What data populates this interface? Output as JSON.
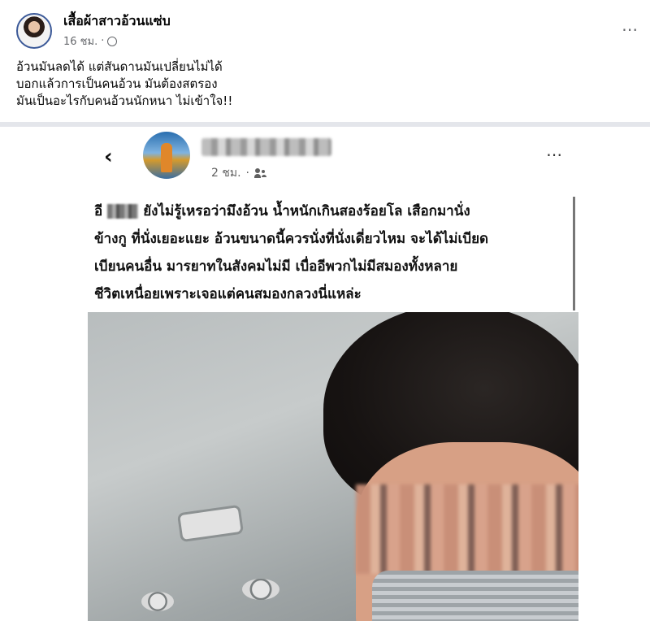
{
  "post": {
    "author": "เสื้อผ้าสาวอ้วนแซ่บ",
    "time": "16 ชม.",
    "more_icon": "⋯",
    "text_lines": [
      "อ้วนมันลดได้ แต่สันดานมันเปลี่ยนไม่ได้",
      "บอกแล้วการเป็นคนอ้วน มันต้องสตรอง",
      "มันเป็นอะไรกับคนอ้วนนักหนา ไม่เข้าใจ!!"
    ]
  },
  "screenshot": {
    "back_icon": "‹",
    "time": "2 ชม.",
    "more_icon": "⋯",
    "quote_prefix": "อี",
    "quote_lines": [
      "ยังไม่รู้เหรอว่ามึงอ้วน น้ำหนักเกินสองร้อยโล เสือกมานั่ง",
      "ข้างกู ที่นั่งเยอะแยะ อ้วนขนาดนี้ควรนั่งที่นั่งเดี่ยวไหม จะได้ไม่เบียด",
      "เบียนคนอื่น มารยาทในสังคมไม่มี เบื่ออีพวกไม่มีสมองทั้งหลาย",
      "ชีวิตเหนื่อยเพราะเจอแต่คนสมองกลวงนี่แหล่ะ"
    ]
  }
}
